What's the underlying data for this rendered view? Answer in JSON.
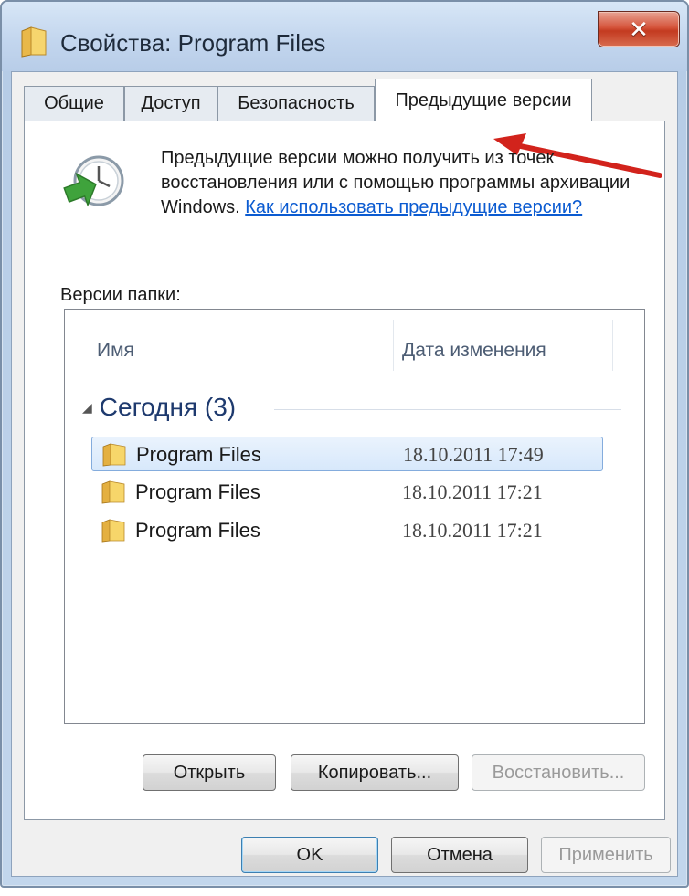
{
  "window": {
    "title": "Свойства: Program Files",
    "close_symbol": "✕",
    "title_icon": "folder-icon"
  },
  "tabs": [
    {
      "label": "Общие",
      "active": false
    },
    {
      "label": "Доступ",
      "active": false
    },
    {
      "label": "Безопасность",
      "active": false
    },
    {
      "label": "Предыдущие версии",
      "active": true
    }
  ],
  "info": {
    "icon": "restore-clock-icon",
    "text": "Предыдущие версии можно получить из точек восстановления или с помощью программы архивации Windows. ",
    "link": "Как использовать предыдущие версии?"
  },
  "versions": {
    "label": "Версии папки:",
    "columns": {
      "name": "Имя",
      "date": "Дата изменения"
    },
    "group": {
      "label": "Сегодня (3)"
    },
    "items": [
      {
        "name": "Program Files",
        "date": "18.10.2011 17:49",
        "selected": true
      },
      {
        "name": "Program Files",
        "date": "18.10.2011 17:21",
        "selected": false
      },
      {
        "name": "Program Files",
        "date": "18.10.2011 17:21",
        "selected": false
      }
    ]
  },
  "actions": {
    "open": "Открыть",
    "copy": "Копировать...",
    "restore": "Восстановить..."
  },
  "dialog": {
    "ok": "OK",
    "cancel": "Отмена",
    "apply": "Применить"
  },
  "colors": {
    "link": "#0b5bd1",
    "annotation_arrow": "#d2231c",
    "close_button": "#c33a20"
  }
}
